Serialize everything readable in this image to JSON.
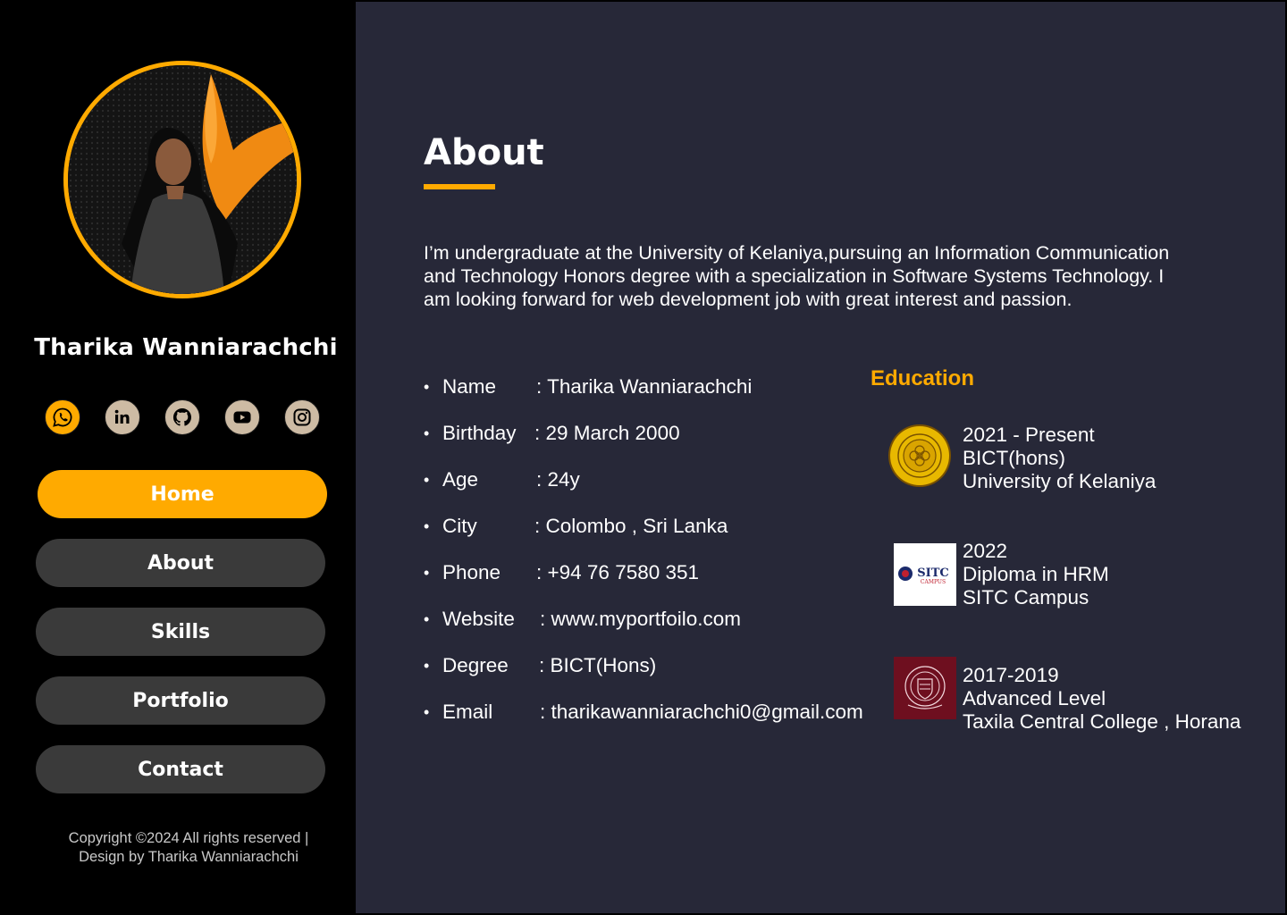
{
  "sidebar": {
    "profile_name": "Tharika Wanniarachchi",
    "socials": [
      {
        "name": "whatsapp-icon",
        "active": true
      },
      {
        "name": "linkedin-icon",
        "active": false
      },
      {
        "name": "github-icon",
        "active": false
      },
      {
        "name": "youtube-icon",
        "active": false
      },
      {
        "name": "instagram-icon",
        "active": false
      }
    ],
    "nav": [
      {
        "label": "Home",
        "active": true
      },
      {
        "label": "About",
        "active": false
      },
      {
        "label": "Skills",
        "active": false
      },
      {
        "label": "Portfolio",
        "active": false
      },
      {
        "label": "Contact",
        "active": false
      }
    ],
    "copyright_line1": "Copyright ©2024 All rights reserved |",
    "copyright_line2": "Design by Tharika Wanniarachchi"
  },
  "about": {
    "title": "About",
    "paragraph_line1": "I’m undergraduate at the University of Kelaniya,pursuing an Information Communication",
    "paragraph_line2": "and Technology Honors degree with a specialization in Software Systems Technology.  I",
    "paragraph_line3": "am looking forward for web development job with great interest and passion.",
    "info": [
      {
        "bullet": "•",
        "label": "Name",
        "value": ": Tharika Wanniarachchi"
      },
      {
        "bullet": "•",
        "label": "Birthday",
        "value": ": 29 March 2000"
      },
      {
        "bullet": "•",
        "label": "Age",
        "value": ": 24y"
      },
      {
        "bullet": "•",
        "label": "City",
        "value": ": Colombo , Sri Lanka"
      },
      {
        "bullet": "•",
        "label": "Phone",
        "value": ": +94 76 7580 351"
      },
      {
        "bullet": "•",
        "label": "Website",
        "value": ": www.myportfoilo.com"
      },
      {
        "bullet": "•",
        "label": "Degree",
        "value": ": BICT(Hons)"
      },
      {
        "bullet": "•",
        "label": "Email",
        "value": ": tharikawanniarachchi0@gmail.com"
      }
    ]
  },
  "education": {
    "title": "Education",
    "items": [
      {
        "logo": "university-of-kelaniya-logo",
        "period": "2021 - Present",
        "qualification": "BICT(hons)",
        "institution": "University of Kelaniya"
      },
      {
        "logo": "sitc-campus-logo",
        "logo_text": "SITC",
        "logo_subtext": "CAMPUS",
        "period": "2022",
        "qualification": "Diploma in HRM",
        "institution": "SITC Campus"
      },
      {
        "logo": "taxila-central-college-logo",
        "period": "2017-2019",
        "qualification": "Advanced Level",
        "institution": "Taxila Central College , Horana"
      }
    ]
  },
  "colors": {
    "accent": "#FFAA00",
    "sidebar_bg": "#000000",
    "main_bg": "#272838",
    "nav_button_bg": "#3A3A3A",
    "social_bg": "#CDBBA4"
  }
}
